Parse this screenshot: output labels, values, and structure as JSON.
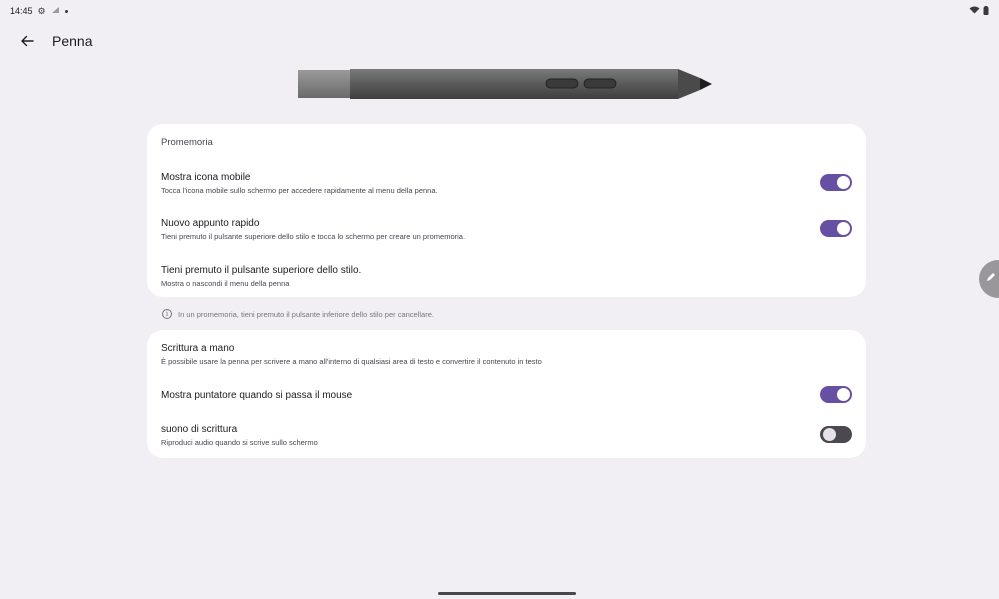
{
  "status_bar": {
    "time": "14:45",
    "left_icons": [
      "settings-icon",
      "signal-icon",
      "notification-dot-icon"
    ],
    "right_icons": [
      "wifi-icon",
      "battery-icon"
    ]
  },
  "app_bar": {
    "title": "Penna",
    "back_icon": "arrow-left-icon"
  },
  "cards": {
    "promemoria": {
      "header": "Promemoria",
      "rows": [
        {
          "title": "Mostra icona mobile",
          "subtitle": "Tocca l'icona mobile sullo schermo per accedere rapidamente al menu della penna.",
          "toggle": true
        },
        {
          "title": "Nuovo appunto rapido",
          "subtitle": "Tieni premuto il pulsante superiore dello stilo e tocca lo schermo per creare un promemoria.",
          "toggle": true
        },
        {
          "title": "Tieni premuto il pulsante superiore dello stilo.",
          "subtitle": "Mostra o nascondi il menu della penna"
        }
      ]
    },
    "info_note": "In un promemoria, tieni premuto il pulsante inferiore dello stilo per cancellare.",
    "scrittura": {
      "rows": [
        {
          "title": "Scrittura a mano",
          "subtitle": "È possibile usare la penna per scrivere a mano all'interno di qualsiasi area di testo e convertire il contenuto in testo"
        },
        {
          "title": "Mostra puntatore quando si passa il mouse",
          "toggle": true
        },
        {
          "title": "suono di scrittura",
          "subtitle": "Riproduci audio quando si scrive sullo schermo",
          "toggle": false
        }
      ]
    }
  },
  "colors": {
    "background": "#f1eff3",
    "card": "#ffffff",
    "toggle_on": "#6750a4",
    "toggle_off": "#4b4850"
  }
}
